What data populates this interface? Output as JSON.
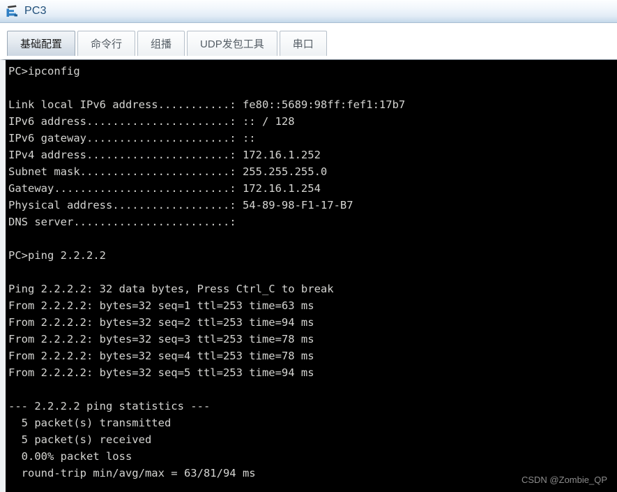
{
  "window": {
    "title": "PC3",
    "icon": "pc-terminal-icon"
  },
  "tabs": [
    {
      "label": "基础配置",
      "selected": true
    },
    {
      "label": "命令行",
      "selected": false
    },
    {
      "label": "组播",
      "selected": false
    },
    {
      "label": "UDP发包工具",
      "selected": false
    },
    {
      "label": "串口",
      "selected": false
    }
  ],
  "terminal": {
    "prompt": "PC>",
    "background": "#000000",
    "foreground": "#d5d5d2",
    "lines": [
      "PC>ipconfig",
      "",
      "Link local IPv6 address...........: fe80::5689:98ff:fef1:17b7",
      "IPv6 address......................: :: / 128",
      "IPv6 gateway......................: ::",
      "IPv4 address......................: 172.16.1.252",
      "Subnet mask.......................: 255.255.255.0",
      "Gateway...........................: 172.16.1.254",
      "Physical address..................: 54-89-98-F1-17-B7",
      "DNS server........................:",
      "",
      "PC>ping 2.2.2.2",
      "",
      "Ping 2.2.2.2: 32 data bytes, Press Ctrl_C to break",
      "From 2.2.2.2: bytes=32 seq=1 ttl=253 time=63 ms",
      "From 2.2.2.2: bytes=32 seq=2 ttl=253 time=94 ms",
      "From 2.2.2.2: bytes=32 seq=3 ttl=253 time=78 ms",
      "From 2.2.2.2: bytes=32 seq=4 ttl=253 time=78 ms",
      "From 2.2.2.2: bytes=32 seq=5 ttl=253 time=94 ms",
      "",
      "--- 2.2.2.2 ping statistics ---",
      "  5 packet(s) transmitted",
      "  5 packet(s) received",
      "  0.00% packet loss",
      "  round-trip min/avg/max = 63/81/94 ms"
    ],
    "ipconfig": {
      "command": "ipconfig",
      "link_local_ipv6_address": "fe80::5689:98ff:fef1:17b7",
      "ipv6_address": ":: / 128",
      "ipv6_gateway": "::",
      "ipv4_address": "172.16.1.252",
      "subnet_mask": "255.255.255.0",
      "gateway": "172.16.1.254",
      "physical_address": "54-89-98-F1-17-B7",
      "dns_server": ""
    },
    "ping": {
      "command": "ping 2.2.2.2",
      "target": "2.2.2.2",
      "data_bytes": "32",
      "break_hint": "Press Ctrl_C to break",
      "replies": [
        {
          "seq": "1",
          "bytes": "32",
          "ttl": "253",
          "time": "63 ms"
        },
        {
          "seq": "2",
          "bytes": "32",
          "ttl": "253",
          "time": "94 ms"
        },
        {
          "seq": "3",
          "bytes": "32",
          "ttl": "253",
          "time": "78 ms"
        },
        {
          "seq": "4",
          "bytes": "32",
          "ttl": "253",
          "time": "78 ms"
        },
        {
          "seq": "5",
          "bytes": "32",
          "ttl": "253",
          "time": "94 ms"
        }
      ],
      "statistics": {
        "header": "--- 2.2.2.2 ping statistics ---",
        "transmitted": "5 packet(s) transmitted",
        "received": "5 packet(s) received",
        "loss": "0.00% packet loss",
        "round_trip": "round-trip min/avg/max = 63/81/94 ms"
      }
    }
  },
  "watermark": {
    "text": "CSDN @Zombie_QP"
  }
}
